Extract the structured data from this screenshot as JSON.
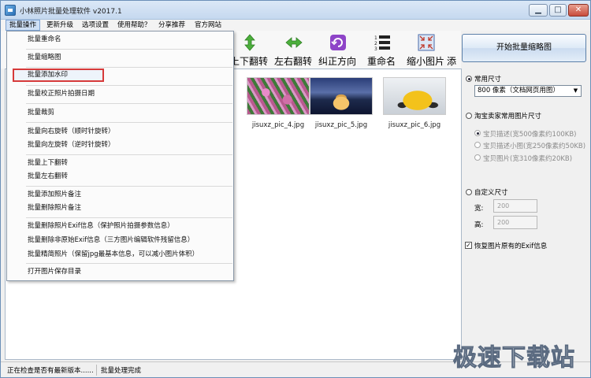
{
  "window": {
    "title": "小林照片批量处理软件 v2017.1"
  },
  "menubar": [
    {
      "label": "批量操作"
    },
    {
      "label": "更新升级"
    },
    {
      "label": "选项设置"
    },
    {
      "label": "使用帮助？"
    },
    {
      "label": "分享推荐"
    },
    {
      "label": "官方网站"
    }
  ],
  "toolbar": [
    {
      "label": "上下翻转",
      "icon": "flip-vertical-icon"
    },
    {
      "label": "左右翻转",
      "icon": "flip-horizontal-icon"
    },
    {
      "label": "纠正方向",
      "icon": "rotate-correct-icon"
    },
    {
      "label": "重命名",
      "icon": "rename-list-icon"
    },
    {
      "label": "缩小图片",
      "icon": "shrink-image-icon"
    },
    {
      "label": "添",
      "icon": ""
    }
  ],
  "dropdown": [
    "批量重命名",
    "批量缩略图",
    "批量添加水印",
    "批量校正照片拍摄日期",
    "批量裁剪",
    "批量向右旋转（顺时针旋转）",
    "批量向左旋转（逆时针旋转）",
    "批量上下翻转",
    "批量左右翻转",
    "批量添加照片备注",
    "批量删除照片备注",
    "批量删除照片Exif信息（保护照片拍摄参数信息）",
    "批量删除非原始Exif信息（三方图片编辑软件残留信息）",
    "批量精简照片（保留jpg最基本信息，可以减小图片体积）",
    "打开图片保存目录"
  ],
  "thumbnails": [
    {
      "name": "jisuxz_pic_4.jpg"
    },
    {
      "name": "jisuxz_pic_5.jpg"
    },
    {
      "name": "jisuxz_pic_6.jpg"
    }
  ],
  "panel": {
    "start_button": "开始批量缩略图",
    "common_size": "常用尺寸",
    "common_size_value": "800 像素（文档网页用图）",
    "taobao": "淘宝卖家常用图片尺寸",
    "taobao_options": [
      "宝贝描述(宽500像素约100KB)",
      "宝贝描述小图(宽250像素约50KB)",
      "宝贝图片(宽310像素约20KB)"
    ],
    "custom": "自定义尺寸",
    "width_label": "宽:",
    "width_value": "200",
    "height_label": "高:",
    "height_value": "200",
    "restore_exif": "恢复图片原有的Exif信息"
  },
  "status": {
    "left": "正在检查是否有最新版本......",
    "right": "批量处理完成"
  },
  "watermark": "极速下载站"
}
